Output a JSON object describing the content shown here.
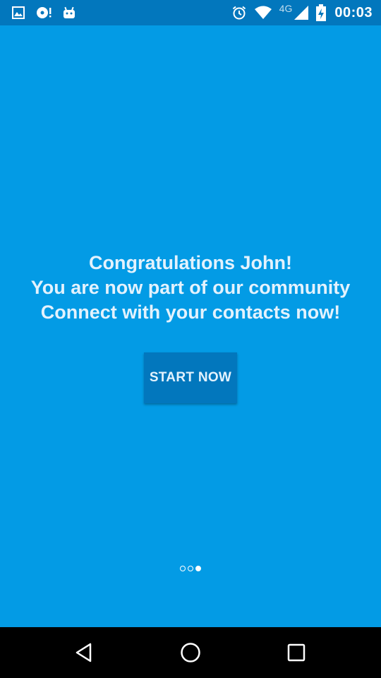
{
  "status_bar": {
    "left_icons": [
      "gallery-icon",
      "disc-alert-icon",
      "android-icon"
    ],
    "right_icons": [
      "alarm-icon",
      "wifi-icon",
      "signal-icon",
      "battery-charging-icon"
    ],
    "network_label": "4G",
    "time": "00:03"
  },
  "main": {
    "message_lines": [
      "Congratulations John!",
      "You are now part of our community",
      "Connect with your contacts now!"
    ],
    "start_button_label": "START NOW"
  },
  "page_indicator": {
    "total": 3,
    "active_index": 2
  },
  "nav_bar": {
    "buttons": [
      "back-icon",
      "home-icon",
      "recents-icon"
    ]
  },
  "colors": {
    "background": "#039BE5",
    "status_bar": "#0277BD",
    "button": "#0277BD",
    "text": "#E3F2FD",
    "nav_bar": "#000000"
  }
}
